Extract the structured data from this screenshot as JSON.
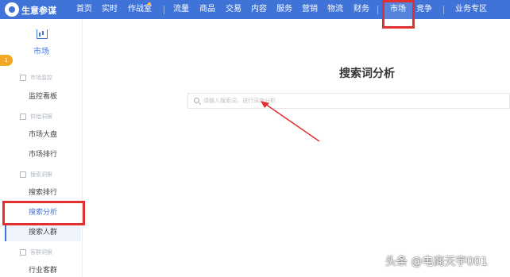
{
  "app": {
    "brand": "生意参谋"
  },
  "nav": {
    "items": [
      "首页",
      "实时",
      "作战室",
      "流量",
      "商品",
      "交易",
      "内容",
      "服务",
      "营销",
      "物流",
      "财务",
      "市场",
      "竞争",
      "业务专区"
    ],
    "active": "市场"
  },
  "sidebar": {
    "module_label": "市场",
    "badge": "1",
    "sections": [
      {
        "title": "市场监控",
        "items": [
          "监控看板"
        ]
      },
      {
        "title": "供给洞察",
        "items": [
          "市场大盘",
          "市场排行"
        ]
      },
      {
        "title": "搜索洞察",
        "items": [
          "搜索排行",
          "搜索分析",
          "搜索人群"
        ]
      },
      {
        "title": "客群洞察",
        "items": [
          "行业客群"
        ]
      }
    ],
    "active_item": "搜索分析"
  },
  "main": {
    "title": "搜索词分析",
    "search": {
      "placeholder": "请输入搜索词，进行深度分析"
    }
  },
  "watermark": "头条 @电商天宇001",
  "colors": {
    "nav_bg": "#3f73d8",
    "accent": "#3f73d8",
    "highlight": "#e03030"
  }
}
